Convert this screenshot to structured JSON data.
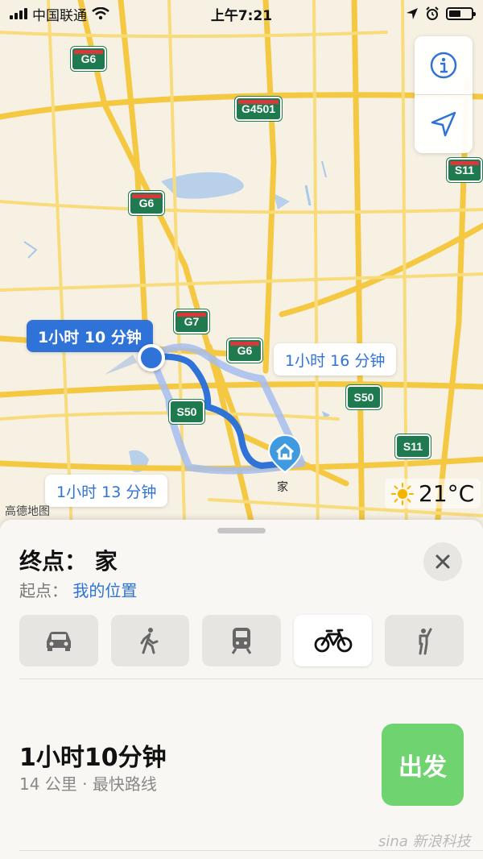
{
  "status_bar": {
    "carrier": "中国联通",
    "time": "上午7:21"
  },
  "map": {
    "attribution": "高德地图",
    "weather": {
      "temperature": "21°C",
      "icon": "sun-icon"
    },
    "shields": [
      {
        "label": "G6"
      },
      {
        "label": "G4501"
      },
      {
        "label": "S11"
      },
      {
        "label": "G6"
      },
      {
        "label": "G7"
      },
      {
        "label": "G6"
      },
      {
        "label": "S50"
      },
      {
        "label": "S50"
      },
      {
        "label": "S11"
      }
    ],
    "route_labels": {
      "primary": "1小时 10 分钟",
      "alt1": "1小时 16 分钟",
      "alt2": "1小时 13 分钟"
    },
    "destination_label": "家",
    "controls": {
      "info_icon": "info-icon",
      "locate_icon": "location-arrow-icon"
    }
  },
  "sheet": {
    "destination": "终点： 家",
    "origin_label": "起点：",
    "origin_value": "我的位置",
    "modes": [
      {
        "icon": "car-icon",
        "active": false
      },
      {
        "icon": "walk-icon",
        "active": false
      },
      {
        "icon": "transit-icon",
        "active": false
      },
      {
        "icon": "bicycle-icon",
        "active": true
      },
      {
        "icon": "rideshare-icon",
        "active": false
      }
    ],
    "route": {
      "time": "1小时10分钟",
      "meta": "14 公里 · 最快路线",
      "go_label": "出发"
    },
    "watermark": "sina 新浪科技"
  },
  "colors": {
    "accent": "#2f72d8",
    "go": "#6fd36f",
    "shield": "#1f7a4f"
  }
}
